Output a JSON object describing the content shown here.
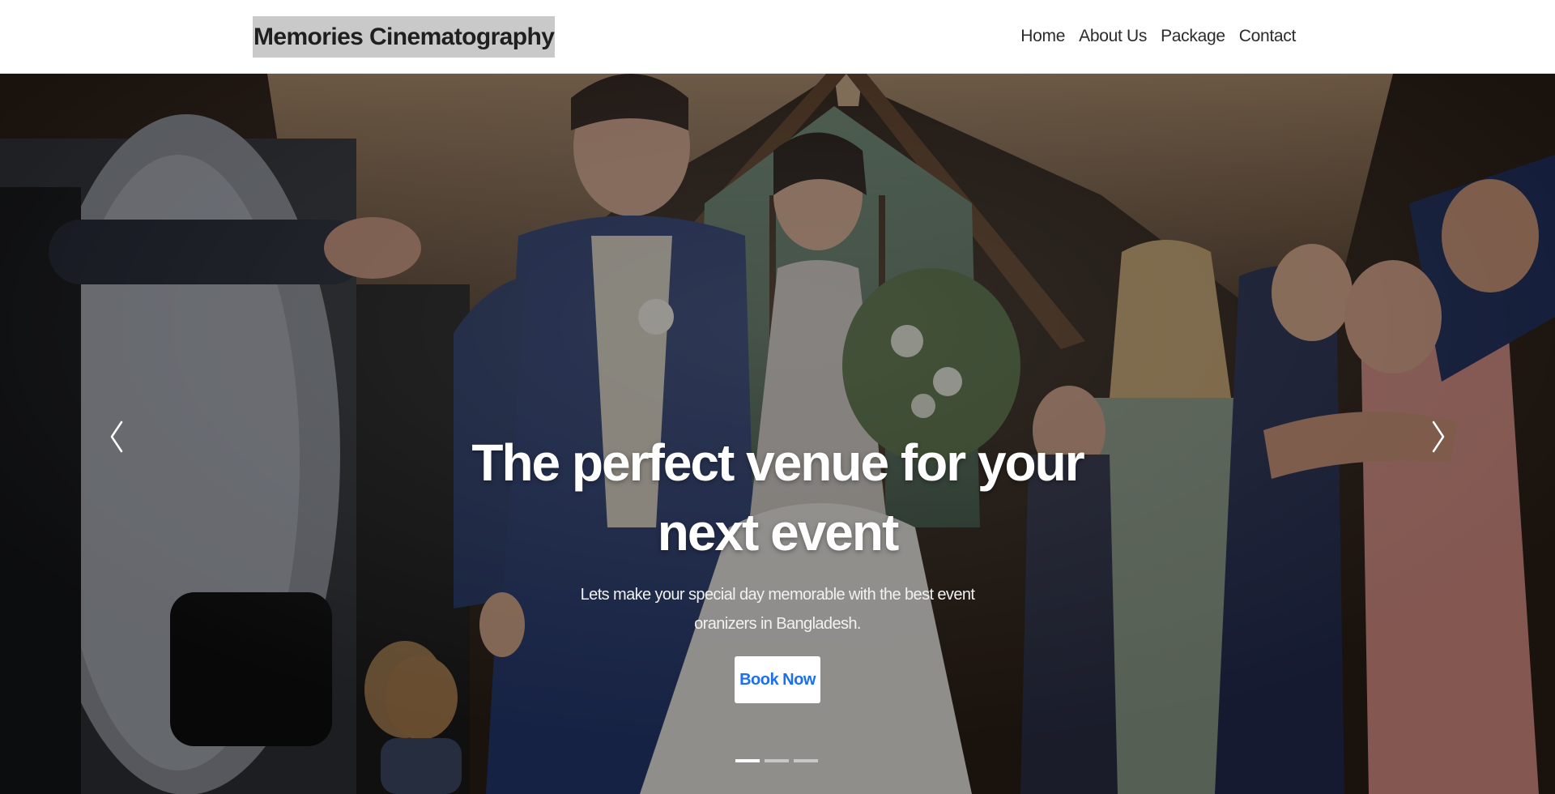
{
  "navbar": {
    "brand": "Memories Cinematography",
    "links": [
      "Home",
      "About Us",
      "Package",
      "Contact"
    ]
  },
  "hero": {
    "headline": "The perfect venue for your next event",
    "subtext": "Lets make your special day memorable with the best event oranizers in Bangladesh.",
    "cta_label": "Book Now",
    "prev_icon": "chevron-left-icon",
    "next_icon": "chevron-right-icon",
    "slide_count": 3,
    "active_slide": 1
  },
  "colors": {
    "cta_text": "#1d6ff2",
    "brand_highlight": "#c9c9c9",
    "nav_text": "#2b2b2b"
  }
}
